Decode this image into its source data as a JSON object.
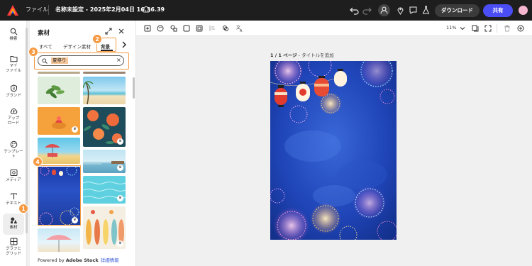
{
  "topbar": {
    "files_label": "ファイル",
    "doc_title": "名称未設定 - 2025年2月04日 16.36.39",
    "download_label": "ダウンロード",
    "share_label": "共有"
  },
  "rail": {
    "items": [
      {
        "label": "検索",
        "icon": "search-icon"
      },
      {
        "label": "マイ\nファイル",
        "icon": "folder-icon"
      },
      {
        "label": "ブランド",
        "icon": "brand-icon"
      },
      {
        "label": "アップ\nロード",
        "icon": "upload-icon"
      },
      {
        "label": "テンプレー\nト",
        "icon": "template-icon"
      },
      {
        "label": "メディア",
        "icon": "media-icon"
      },
      {
        "label": "テキスト",
        "icon": "text-icon"
      },
      {
        "label": "素材",
        "icon": "elements-icon"
      },
      {
        "label": "グラフと\nグリッド",
        "icon": "grid-icon"
      }
    ]
  },
  "panel": {
    "title": "素材",
    "tabs": [
      "すべて",
      "デザイン素材",
      "背景"
    ],
    "active_tab": "背景",
    "search_value": "夏祭り",
    "footer_prefix": "Powered by ",
    "footer_brand": "Adobe Stock",
    "footer_link": "詳細情報"
  },
  "badges": [
    "1",
    "2",
    "3",
    "4"
  ],
  "canvas": {
    "zoom": "11%",
    "page_num": "1 / 1 ページ",
    "page_title_placeholder": "- タイトルを追加"
  },
  "colors": {
    "accent": "#f59a42",
    "share": "#4b4df5",
    "topbar": "#1e1e1e"
  }
}
